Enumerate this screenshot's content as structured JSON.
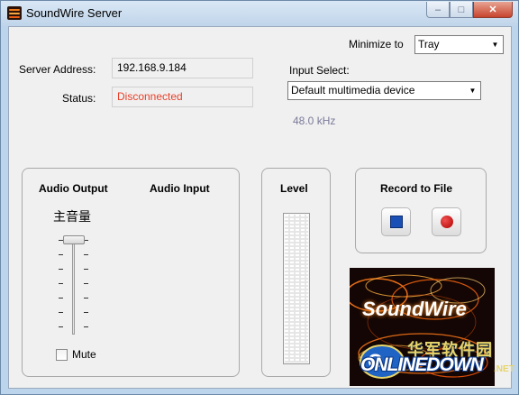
{
  "window": {
    "title": "SoundWire Server",
    "controls": {
      "minimize": "–",
      "maximize": "□",
      "close": "✕"
    }
  },
  "server": {
    "address_label": "Server Address:",
    "address_value": "192.168.9.184",
    "status_label": "Status:",
    "status_value": "Disconnected",
    "status_color": "#e8402a"
  },
  "minimize_to": {
    "label": "Minimize to",
    "value": "Tray"
  },
  "input_select": {
    "label": "Input Select:",
    "value": "Default multimedia device"
  },
  "sample_rate": "48.0 kHz",
  "audio_panel": {
    "output_heading": "Audio Output",
    "input_heading": "Audio Input",
    "volume_label": "主音量",
    "volume_level": 1.0,
    "mute_label": "Mute",
    "mute_checked": false
  },
  "level_panel": {
    "heading": "Level",
    "level": 0
  },
  "record_panel": {
    "heading": "Record to File"
  },
  "logo": {
    "text": "SoundWire"
  },
  "watermark": {
    "cn": "华军软件园",
    "en": "ONLINEDOWN",
    "suffix": ".NET"
  }
}
